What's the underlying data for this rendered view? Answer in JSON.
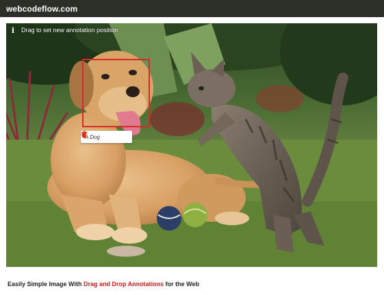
{
  "header": {
    "site_title": "webcodeflow.com"
  },
  "photo": {
    "hint_text": "Drag to set new annotation position",
    "annotation": {
      "label": "A Dog",
      "icons": [
        "refresh-icon",
        "trash-icon"
      ],
      "box_color": "#d62a2a"
    }
  },
  "caption": {
    "prefix": "Easily Simple Image With ",
    "highlight": "Drag and Drop Annotations",
    "suffix": " for the Web",
    "highlight_color": "#d11b1b"
  }
}
